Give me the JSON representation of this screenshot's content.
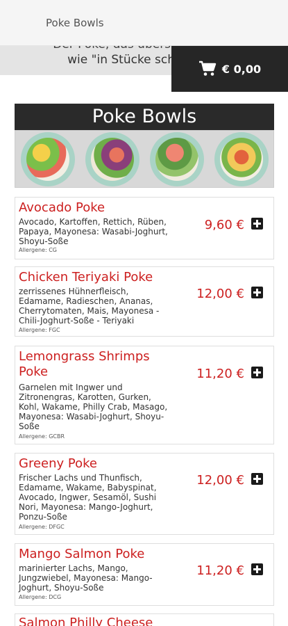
{
  "app_bar": {
    "title": "Poke Bowls"
  },
  "intro": {
    "line1": "Der Poké, das übersetzt so viel",
    "line2": "wie \"in Stücke schneiden\""
  },
  "cart": {
    "icon": "shopping-cart-icon",
    "amount": "€ 0,00"
  },
  "section": {
    "title": "Poke Bowls"
  },
  "menu_items": [
    {
      "name": "Avocado Poke",
      "description": "Avocado, Kartoffen, Rettich, Rüben, Papaya, Mayonesa: Wasabi-Joghurt, Shoyu-Soße",
      "allergens": "Allergene: CG",
      "price": "9,60 €"
    },
    {
      "name": "Chicken Teriyaki Poke",
      "description": "zerrissenes Hühnerfleisch, Edamame, Radieschen, Ananas, Cherrytomaten, Mais, Mayonesa - Chili-Joghurt-Soße - Teriyaki",
      "allergens": "Allergene: FGC",
      "price": "12,00 €"
    },
    {
      "name": "Lemongrass Shrimps Poke",
      "description": "Garnelen mit Ingwer und Zitronengras, Karotten, Gurken, Kohl, Wakame, Philly Crab, Masago, Mayonesa: Wasabi-Joghurt, Shoyu-Soße",
      "allergens": "Allergene: GCBR",
      "price": "11,20 €"
    },
    {
      "name": "Greeny Poke",
      "description": "Frischer Lachs und Thunfisch, Edamame, Wakame, Babyspinat, Avocado, Ingwer, Sesamöl, Sushi Nori, Mayonesa: Mango-Joghurt, Ponzu-Soße",
      "allergens": "Allergene: DFGC",
      "price": "12,00 €"
    },
    {
      "name": "Mango Salmon Poke",
      "description": "marinierter Lachs, Mango, Jungzwiebel, Mayonesa: Mango-Joghurt, Shoyu-Soße",
      "allergens": "Allergene: DCG",
      "price": "11,20 €"
    },
    {
      "name": "Salmon Philly Cheese",
      "description": "",
      "allergens": "",
      "price": ""
    }
  ],
  "colors": {
    "accent": "#cc1f1f",
    "header_bg": "#2a2a2a",
    "cart_bg": "#262626"
  }
}
